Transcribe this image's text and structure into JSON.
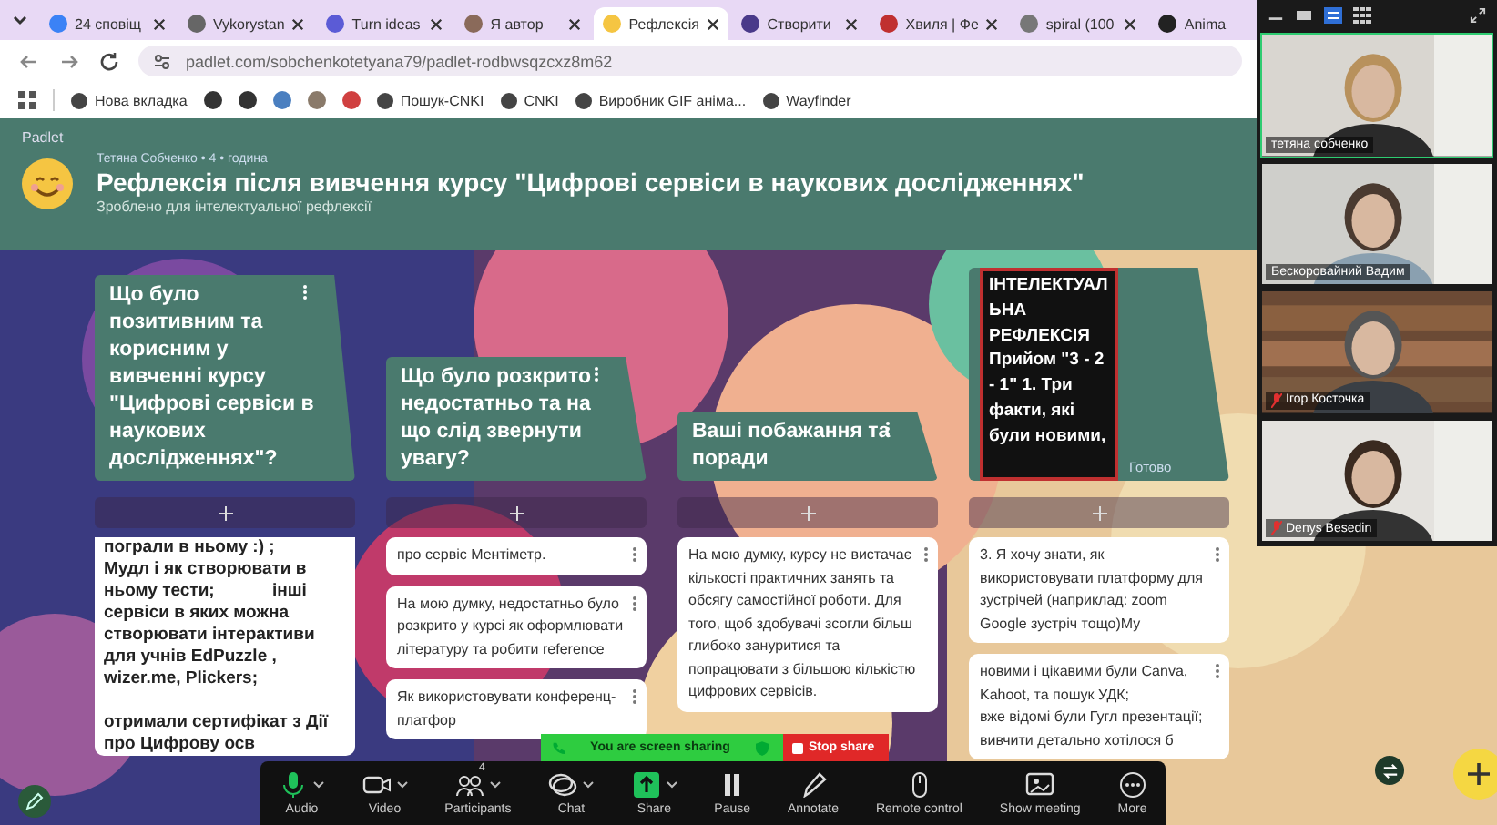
{
  "browser": {
    "tabs": [
      {
        "label": "24 сповіщ",
        "selected": false
      },
      {
        "label": "Vykorystan",
        "selected": false
      },
      {
        "label": "Turn ideas",
        "selected": false
      },
      {
        "label": "Я автор",
        "selected": false
      },
      {
        "label": "Рефлексія",
        "selected": true
      },
      {
        "label": "Створити",
        "selected": false
      },
      {
        "label": "Хвиля | Фе",
        "selected": false
      },
      {
        "label": "spiral (100",
        "selected": false
      },
      {
        "label": "Anima",
        "selected": false
      }
    ],
    "address": "padlet.com/sobchenkotetyana79/padlet-rodbwsqzcxz8m62",
    "bookmarks": [
      {
        "kind": "link",
        "label": "Нова вкладка"
      },
      {
        "kind": "icon"
      },
      {
        "kind": "icon"
      },
      {
        "kind": "icon"
      },
      {
        "kind": "icon"
      },
      {
        "kind": "icon"
      },
      {
        "kind": "link",
        "label": "Пошук-CNKI"
      },
      {
        "kind": "link",
        "label": "CNKI"
      },
      {
        "kind": "link",
        "label": "Виробник GIF аніма..."
      },
      {
        "kind": "link",
        "label": "Wayfinder"
      }
    ]
  },
  "padlet": {
    "app_name": "Padlet",
    "author_line": "Тетяна Собченко • 4 • година",
    "title": "Рефлексія після вивчення курсу \"Цифрові сервіси в наукових дослідженнях\"",
    "subtitle": "Зроблено для інтелектуальної рефлексії",
    "columns": [
      {
        "kind": "section",
        "title": "Що було позитивним та корисним у вивченні курсу \"Цифрові сервіси в наукових дослідженнях\"?",
        "cards": [
          {
            "bold": true,
            "text": "пограли в ньому :) ;\nМудл і як створювати в\nньому тести;            інші\nсервіси в яких можна\nстворювати інтерактиви\nдля учнів EdPuzzle ,\nwizer.me, Plickers;\n\nотримали сертифікат з Дії\nпро Цифрову осв"
          }
        ]
      },
      {
        "kind": "section",
        "title": "Що було розкрито недостатньо та на що слід звернути увагу?",
        "cards": [
          {
            "bold": false,
            "text": "про сервіс Ментіметр."
          },
          {
            "bold": false,
            "text": "На мою думку, недостатньо було розкрито у курсі як оформлювати літературу та робити reference"
          },
          {
            "bold": false,
            "text": "Як використовувати конференц-платфор"
          }
        ]
      },
      {
        "kind": "section",
        "title": "Ваші побажання та поради",
        "cards": [
          {
            "bold": false,
            "text": "На мою думку, курсу не вистачає кількості практичних занять та обсягу самостійної роботи. Для того, щоб здобувачі зсогли більш глибоко зануритися та попрацювати з більшою кількістю цифрових сервісів."
          }
        ]
      },
      {
        "kind": "editing",
        "title": "ІНТЕЛЕКТУАЛЬНА РЕФЛЕКСІЯ Прийом \"3 - 2 - 1\"        1. Три факти, які були новими,",
        "action": "Готово",
        "cards": [
          {
            "bold": false,
            "text": "3. Я хочу знати, як використовувати платформу для зустрічей (наприклад: zoom Google зустріч тощо)Му"
          },
          {
            "bold": false,
            "text": "новими і цікавими були Canva, Kahoot, та пошук УДК;\nвже відомі були Гугл презентації; вивчити детально хотілося б"
          }
        ]
      }
    ]
  },
  "zoom": {
    "banner": {
      "status": "You are screen sharing",
      "stop": "Stop share"
    },
    "toolbar": [
      {
        "label": "Audio",
        "active": true,
        "menu": true
      },
      {
        "label": "Video",
        "active": false,
        "menu": true
      },
      {
        "label": "Participants",
        "active": false,
        "menu": true,
        "badge": "4"
      },
      {
        "label": "Chat",
        "active": false,
        "menu": true
      },
      {
        "label": "Share",
        "active": true,
        "menu": true
      },
      {
        "label": "Pause",
        "active": false,
        "menu": false
      },
      {
        "label": "Annotate",
        "active": false,
        "menu": false
      },
      {
        "label": "Remote control",
        "active": false,
        "menu": false
      },
      {
        "label": "Show meeting",
        "active": false,
        "menu": false
      },
      {
        "label": "More",
        "active": false,
        "menu": false
      }
    ],
    "participants": [
      {
        "name": "тетяна собченко",
        "speaking": true,
        "muted": false
      },
      {
        "name": "Бескоровайний Вадим",
        "speaking": false,
        "muted": false
      },
      {
        "name": "Ігор Косточка",
        "speaking": false,
        "muted": true
      },
      {
        "name": "Denys Besedin",
        "speaking": false,
        "muted": true
      }
    ]
  }
}
